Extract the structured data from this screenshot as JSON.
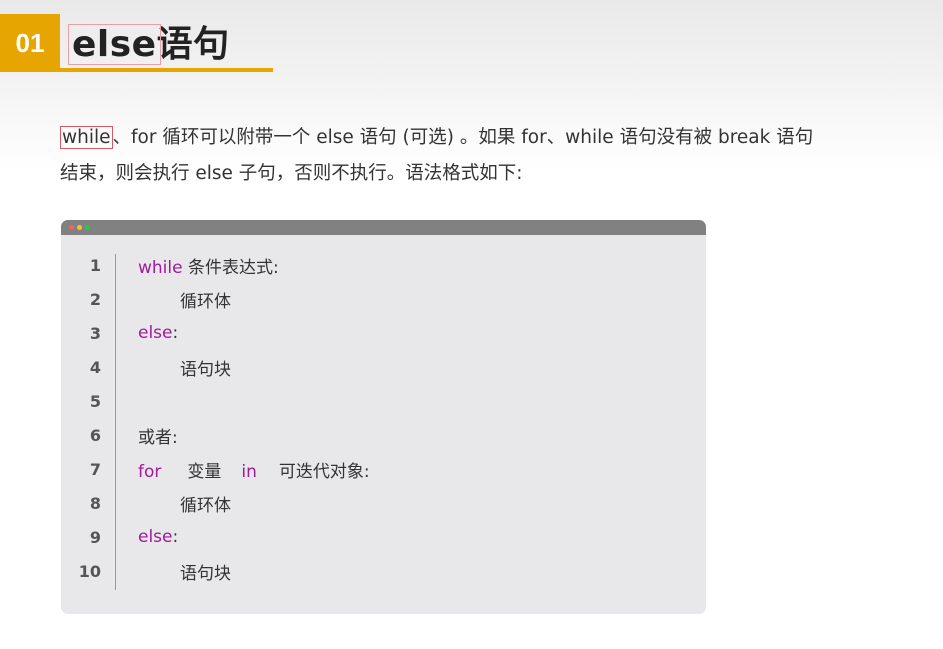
{
  "header": {
    "number": "01",
    "title_marked": "else",
    "title_rest": "语句"
  },
  "intro": {
    "boxed_word": "while",
    "text_line1_rest": "、for 循环可以附带一个 else 语句 (可选) 。如果 for、while 语句没有被 break 语句",
    "text_line2": "结束，则会执行 else 子句，否则不执行。语法格式如下:"
  },
  "code": {
    "lines": [
      {
        "num": "1",
        "kw": "while",
        "text": " 条件表达式:"
      },
      {
        "num": "2",
        "text": "循环体"
      },
      {
        "num": "3",
        "kw": "else",
        "text": ":"
      },
      {
        "num": "4",
        "text": "语句块"
      },
      {
        "num": "5",
        "text": ""
      },
      {
        "num": "6",
        "text": "或者:"
      },
      {
        "num": "7",
        "kw": "for",
        "text_a": "变量",
        "kw2": "in",
        "text_b": "可迭代对象:"
      },
      {
        "num": "8",
        "text": "循环体"
      },
      {
        "num": "9",
        "kw": "else",
        "text": ":"
      },
      {
        "num": "10",
        "text": "语句块"
      }
    ]
  },
  "colors": {
    "accent": "#e6a500",
    "keyword": "#a21a9c",
    "highlight_box": "#d45a64"
  }
}
